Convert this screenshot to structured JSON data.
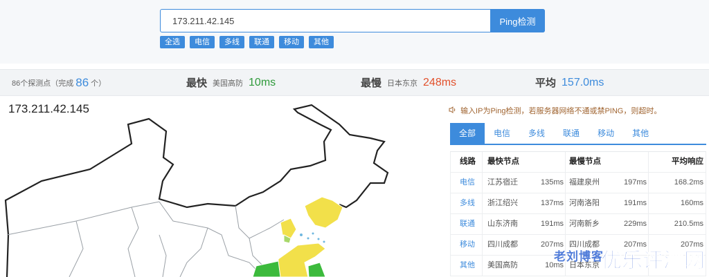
{
  "search": {
    "value": "173.211.42.145",
    "button": "Ping检测"
  },
  "filters": [
    "全选",
    "电信",
    "多线",
    "联通",
    "移动",
    "其他"
  ],
  "stats": {
    "probe_prefix": "86个探测点（完成",
    "probe_done": "86",
    "probe_suffix": "个）",
    "fastest_label": "最快",
    "fastest_node": "美国高防",
    "fastest_value": "10ms",
    "slowest_label": "最慢",
    "slowest_node": "日本东京",
    "slowest_value": "248ms",
    "avg_label": "平均",
    "avg_value": "157.0ms"
  },
  "map": {
    "ip": "173.211.42.145"
  },
  "notice": "输入IP为Ping检测，若服务器网络不通或禁PING，则超时。",
  "tabs": [
    "全部",
    "电信",
    "多线",
    "联通",
    "移动",
    "其他"
  ],
  "table": {
    "headers": {
      "line": "线路",
      "fastest": "最快节点",
      "slowest": "最慢节点",
      "avg": "平均响应"
    },
    "rows": [
      {
        "line": "电信",
        "fast_node": "江苏宿迁",
        "fast_ms": "135ms",
        "slow_node": "福建泉州",
        "slow_ms": "197ms",
        "avg": "168.2ms"
      },
      {
        "line": "多线",
        "fast_node": "浙江绍兴",
        "fast_ms": "137ms",
        "slow_node": "河南洛阳",
        "slow_ms": "191ms",
        "avg": "160ms"
      },
      {
        "line": "联通",
        "fast_node": "山东济南",
        "fast_ms": "191ms",
        "slow_node": "河南新乡",
        "slow_ms": "229ms",
        "avg": "210.5ms"
      },
      {
        "line": "移动",
        "fast_node": "四川成都",
        "fast_ms": "207ms",
        "slow_node": "四川成都",
        "slow_ms": "207ms",
        "avg": "207ms"
      },
      {
        "line": "其他",
        "fast_node": "美国高防",
        "fast_ms": "10ms",
        "slow_node": "日本东京",
        "slow_ms": "",
        "avg": ""
      }
    ]
  },
  "watermark": {
    "left": "老刘博客",
    "right": "优乐评测网"
  },
  "colors": {
    "accent": "#3d8bdc",
    "fast": "#2e9a3a",
    "slow": "#e2502b",
    "map_yellow": "#f2e04a",
    "map_green": "#3cba3c"
  }
}
